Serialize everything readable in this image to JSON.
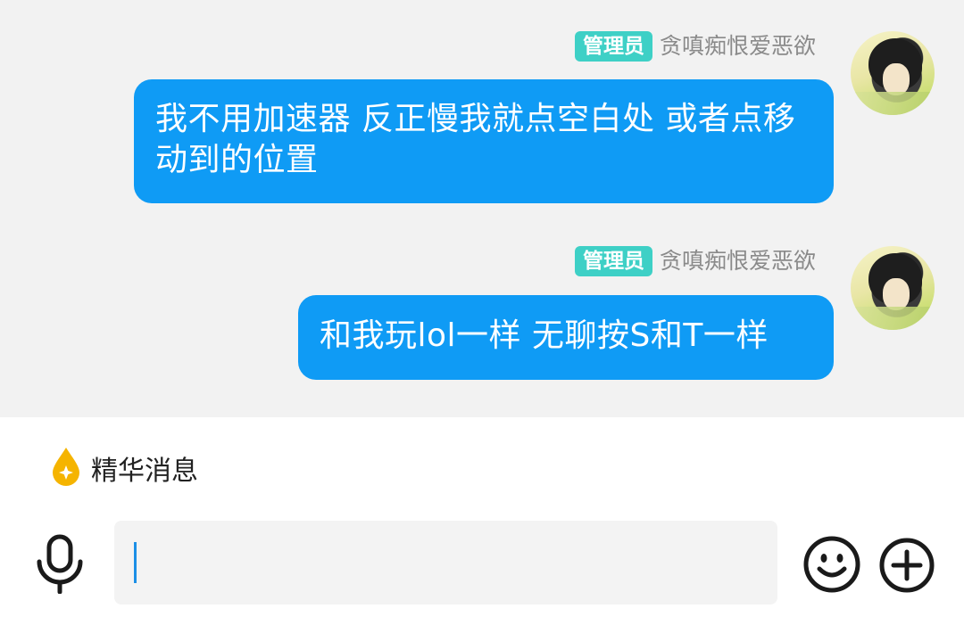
{
  "messages": [
    {
      "role_badge": "管理员",
      "username": "贪嗔痴恨爱恶欲",
      "text": "我不用加速器  反正慢我就点空白处  或者点移动到的位置"
    },
    {
      "role_badge": "管理员",
      "username": "贪嗔痴恨爱恶欲",
      "text": "和我玩lol一样  无聊按S和T一样"
    }
  ],
  "essence": {
    "label": "精华消息",
    "icon": "droplet-star-icon",
    "icon_color": "#f5b400"
  },
  "input": {
    "value": "",
    "placeholder": ""
  },
  "icons": {
    "mic": "microphone-icon",
    "emoji": "smiley-icon",
    "plus": "plus-circle-icon"
  },
  "colors": {
    "bubble": "#0f9bf5",
    "badge": "#3ed0c6",
    "chat_bg": "#f2f2f2"
  }
}
